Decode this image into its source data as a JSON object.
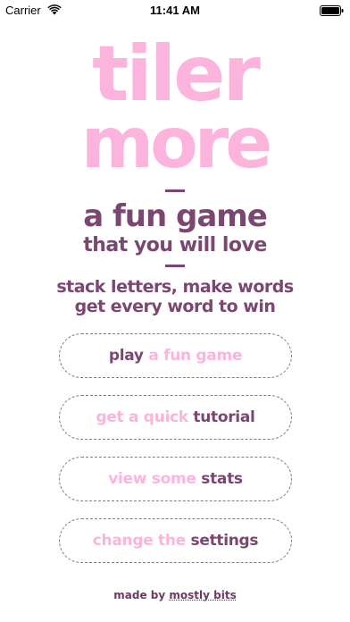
{
  "status_bar": {
    "carrier": "Carrier",
    "time": "11:41 AM",
    "wifi_icon": "wifi-icon",
    "battery_icon": "battery-icon"
  },
  "logo": {
    "line1": "tiler",
    "line2": "more"
  },
  "tagline": {
    "line1": "a fun game",
    "line2": "that you will love"
  },
  "description": {
    "line1": "stack letters, make words",
    "line2": "get every word to win"
  },
  "menu": {
    "play": {
      "strong": "play",
      "soft": " a fun game"
    },
    "tutorial": {
      "soft": "get a quick ",
      "strong": "tutorial"
    },
    "stats": {
      "soft": "view some ",
      "strong": "stats"
    },
    "settings": {
      "soft": "change the ",
      "strong": "settings"
    }
  },
  "footer": {
    "prefix": "made by ",
    "brand": "mostly bits"
  },
  "colors": {
    "pink": "#fdb4dc",
    "plum": "#7b4770",
    "background": "#ffffff"
  }
}
